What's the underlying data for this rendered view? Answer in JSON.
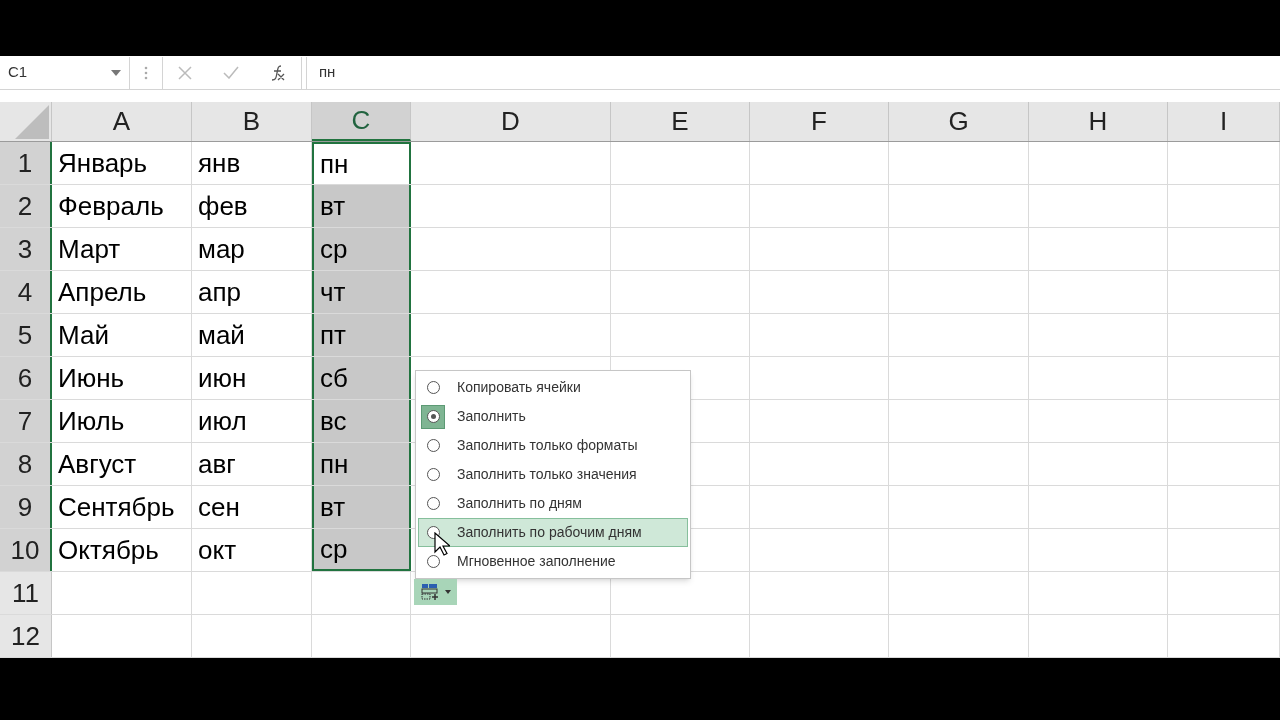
{
  "formula_bar": {
    "name_box": "C1",
    "formula": "пн"
  },
  "columns": [
    {
      "label": "A",
      "selected": false
    },
    {
      "label": "B",
      "selected": false
    },
    {
      "label": "C",
      "selected": true
    },
    {
      "label": "D",
      "selected": false
    },
    {
      "label": "E",
      "selected": false
    },
    {
      "label": "F",
      "selected": false
    },
    {
      "label": "G",
      "selected": false
    },
    {
      "label": "H",
      "selected": false
    },
    {
      "label": "I",
      "selected": false
    }
  ],
  "rows": [
    {
      "label": "1",
      "selected": true,
      "cells": [
        "Январь",
        "янв",
        "пн"
      ]
    },
    {
      "label": "2",
      "selected": true,
      "cells": [
        "Февраль",
        "фев",
        "вт"
      ]
    },
    {
      "label": "3",
      "selected": true,
      "cells": [
        "Март",
        "мар",
        "ср"
      ]
    },
    {
      "label": "4",
      "selected": true,
      "cells": [
        "Апрель",
        "апр",
        "чт"
      ]
    },
    {
      "label": "5",
      "selected": true,
      "cells": [
        "Май",
        "май",
        "пт"
      ]
    },
    {
      "label": "6",
      "selected": true,
      "cells": [
        "Июнь",
        "июн",
        "сб"
      ]
    },
    {
      "label": "7",
      "selected": true,
      "cells": [
        "Июль",
        "июл",
        "вс"
      ]
    },
    {
      "label": "8",
      "selected": true,
      "cells": [
        "Август",
        "авг",
        "пн"
      ]
    },
    {
      "label": "9",
      "selected": true,
      "cells": [
        "Сентябрь",
        "сен",
        "вт"
      ]
    },
    {
      "label": "10",
      "selected": true,
      "cells": [
        "Октябрь",
        "окт",
        "ср"
      ]
    },
    {
      "label": "11",
      "selected": false,
      "cells": []
    },
    {
      "label": "12",
      "selected": false,
      "cells": []
    }
  ],
  "fill_menu": [
    {
      "label": "Копировать ячейки",
      "selected": false,
      "highlighted": false
    },
    {
      "label": "Заполнить",
      "selected": true,
      "highlighted": false
    },
    {
      "label": "Заполнить только форматы",
      "selected": false,
      "highlighted": false
    },
    {
      "label": "Заполнить только значения",
      "selected": false,
      "highlighted": false
    },
    {
      "label": "Заполнить по дням",
      "selected": false,
      "highlighted": false
    },
    {
      "label": "Заполнить по рабочим дням",
      "selected": false,
      "highlighted": true
    },
    {
      "label": "Мгновенное заполнение",
      "selected": false,
      "highlighted": false
    }
  ]
}
